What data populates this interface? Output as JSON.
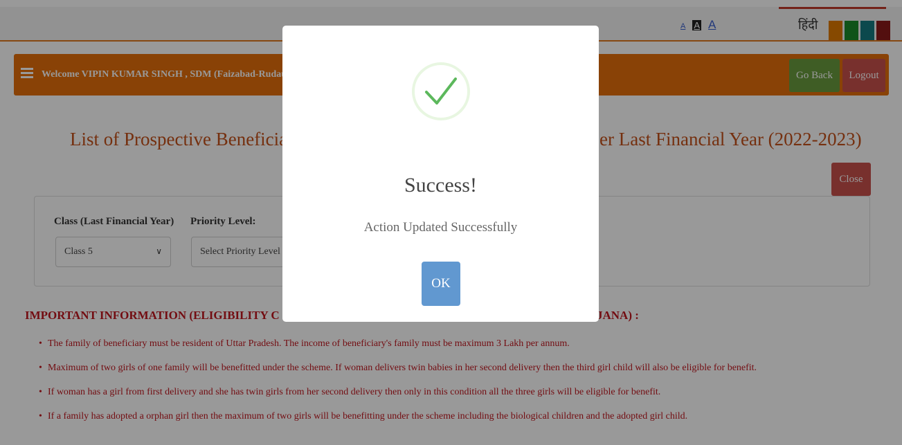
{
  "topbar": {
    "font_small": "A",
    "font_normal": "A",
    "font_large": "A",
    "language": "हिंदी",
    "themes": [
      "#e07a00",
      "#1a8a2a",
      "#147a80",
      "#8b1a1a"
    ],
    "accent": "#c0392b"
  },
  "header": {
    "welcome": "Welcome VIPIN KUMAR SINGH , SDM (Faizabad-Rudauli",
    "go_back": "Go Back",
    "logout": "Logout",
    "color": "#e46f0a"
  },
  "main": {
    "title_left": "List of Prospective Beneficiarie",
    "title_right": "er Last Financial Year (2022-2023)",
    "close": "Close",
    "filters": {
      "class_label": "Class (Last Financial Year)",
      "class_value": "Class 5",
      "priority_label": "Priority Level:",
      "priority_value": "Select Priority Level"
    },
    "info_heading_left": "IMPORTANT INFORMATION (ELIGIBILITY C",
    "info_heading_right": "JANA) :",
    "info_items": [
      "The family of beneficiary must be resident of Uttar Pradesh. The income of beneficiary's family must be maximum 3 Lakh per annum.",
      "Maximum of two girls of one family will be benefitted under the scheme. If woman delivers twin babies in her second delivery then the third girl child will also be eligible for benefit.",
      "If woman has a girl from first delivery and she has twin girls from her second delivery then only in this condition all the three girls will be eligible for benefit.",
      "If a family has adopted a orphan girl then the maximum of two girls will be benefitting under the scheme including the biological children and the adopted girl child."
    ]
  },
  "modal": {
    "icon": "checkmark-icon",
    "title": "Success!",
    "message": "Action Updated Successfully",
    "ok": "OK",
    "check_color": "#5cb85c",
    "ok_color": "#6198d0"
  }
}
